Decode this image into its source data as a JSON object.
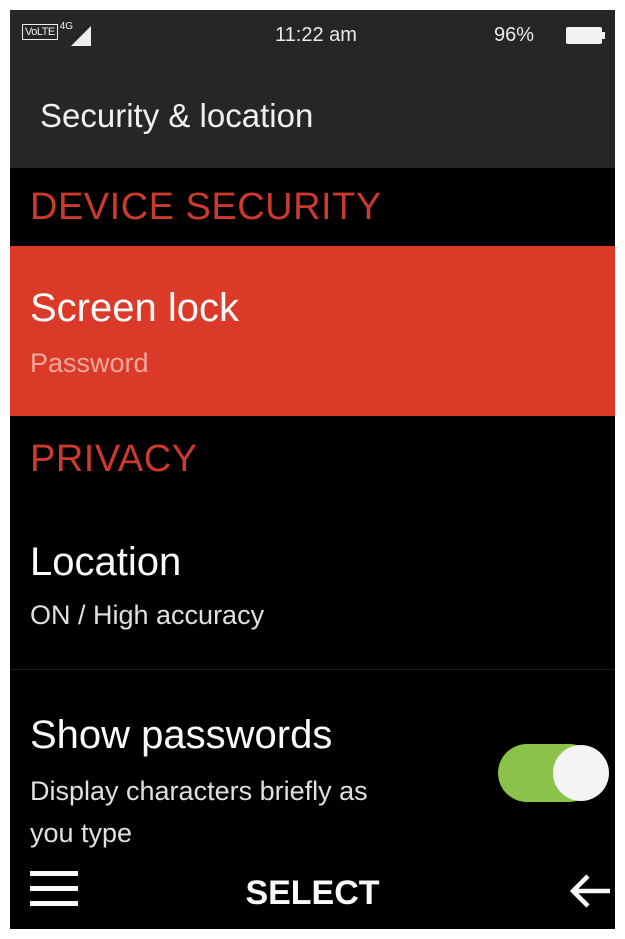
{
  "status_bar": {
    "volte_label": "VoLTE",
    "network_label": "4G",
    "time": "11:22 am",
    "battery_text": "96%",
    "battery_level": 0.96,
    "icons": [
      "signal-icon",
      "battery-icon"
    ]
  },
  "header": {
    "title": "Security & location"
  },
  "sections": {
    "device_security": "DEVICE SECURITY",
    "privacy": "PRIVACY"
  },
  "items": {
    "screen_lock": {
      "title": "Screen lock",
      "subtitle": "Password",
      "selected": true
    },
    "location": {
      "title": "Location",
      "subtitle": "ON / High accuracy"
    },
    "show_passwords": {
      "title": "Show passwords",
      "subtitle_line1": "Display characters briefly as",
      "subtitle_line2": "you type",
      "toggle_on": true
    }
  },
  "bottom_bar": {
    "center_label": "SELECT",
    "left_icon": "menu-icon",
    "right_icon": "back-arrow-icon"
  },
  "colors": {
    "accent": "#dc3a28",
    "section_text": "#cc3a2e",
    "toggle_on": "#8bc34a",
    "header_bg": "#262626"
  }
}
